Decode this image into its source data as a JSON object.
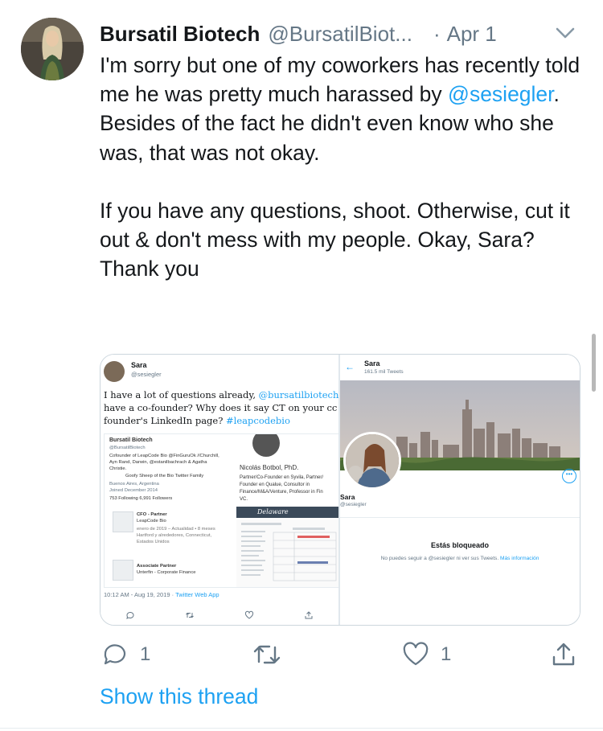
{
  "tweet": {
    "author_name": "Bursatil Biotech",
    "author_handle": "@BursatilBiot...",
    "dot": "·",
    "date": "Apr 1",
    "text_1a": "I'm sorry but one of my coworkers has recently told me he was pretty much harassed by ",
    "mention": "@sesiegler",
    "text_1b": ".",
    "text_2": "Besides of the fact he didn't even know who she was, that was not okay.",
    "text_3": "If you have any questions, shoot. Otherwise, cut it out & don't mess with my people. Okay, Sara?",
    "text_4": "Thank you",
    "reply_count": "1",
    "like_count": "1",
    "show_thread": "Show this thread"
  },
  "media_left": {
    "name": "Sara",
    "handle": "@sesiegler",
    "line1a": "I have a lot of questions already, ",
    "line1b": "@bursatilbiotech.",
    "line2": "have a co-founder?  Why does it say CT on your cc",
    "line3a": "founder's LinkedIn page? ",
    "line3b": "#leapcodebio",
    "profile_title": "Bursatil Biotech",
    "profile_handle": "@BursatilBiotech",
    "profile_bio1": "Cofounder of LeapCode Bio @FinGuruOk //Churchill,",
    "profile_bio2": "Ayn Rand, Darwin, @estanilbachrach & Agatha",
    "profile_bio3": "Christie.",
    "profile_bio4": "Goofy Sheep of the Bio Twitter Family",
    "profile_loc": "Buenos Aires, Argentina",
    "profile_joined": "Joined December 2014",
    "profile_following": "753 Following   6,991 Followers",
    "job1_title": "CFO - Partner",
    "job1_co": "LeapCode Bio",
    "job1_dates": "enero de 2019 – Actualidad • 8 meses",
    "job1_place": "Hartford y alrededores, Connecticut,",
    "job1_country": "Estados Unidos",
    "job2_title": "Associate Partner",
    "job2_co": "Unterfin - Corporate Finance",
    "person_name": "Nicolás Botbol, PhD.",
    "person_bio1": "Partner/Co-Founder en Syvila, Partner/",
    "person_bio2": "Founder en Qualue, Consultor in",
    "person_bio3": "Finance/M&A/Venture, Professor in Fin",
    "person_bio4": "VC.",
    "delaware": "Delaware",
    "time": "10:12 AM - Aug 19, 2019 · ",
    "via": "Twitter Web App"
  },
  "media_right": {
    "back": "←",
    "name": "Sara",
    "tweet_count": "161.5 mil Tweets",
    "profile_name": "Sara",
    "profile_handle": "@sesiegler",
    "more": "•••",
    "blocked_title": "Estás bloqueado",
    "blocked_sub": "No puedes seguir a @sesiegler ni ver sus Tweets. ",
    "blocked_link": "Más información"
  },
  "colors": {
    "accent": "#1da1f2",
    "muted": "#657786",
    "text": "#14171a"
  }
}
